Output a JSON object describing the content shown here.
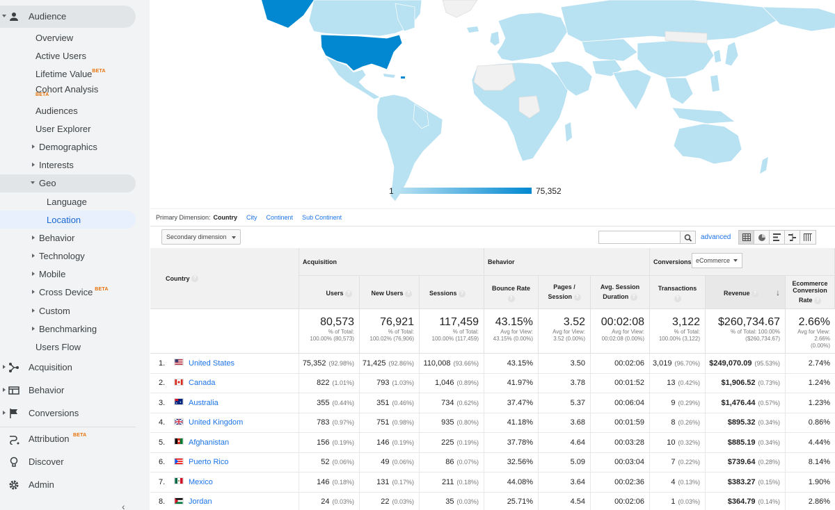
{
  "sidebar": {
    "audience": "Audience",
    "items": {
      "overview": "Overview",
      "active_users": "Active Users",
      "lifetime_value": "Lifetime Value",
      "lifetime_value_badge": "BETA",
      "cohort_analysis": "Cohort Analysis",
      "cohort_badge": "BETA",
      "audiences": "Audiences",
      "user_explorer": "User Explorer",
      "demographics": "Demographics",
      "interests": "Interests",
      "geo": "Geo",
      "language": "Language",
      "location": "Location",
      "behavior": "Behavior",
      "technology": "Technology",
      "mobile": "Mobile",
      "cross_device": "Cross Device",
      "cross_device_badge": "BETA",
      "custom": "Custom",
      "benchmarking": "Benchmarking",
      "users_flow": "Users Flow"
    },
    "acquisition": "Acquisition",
    "behavior": "Behavior",
    "conversions": "Conversions",
    "attribution": "Attribution",
    "attribution_badge": "BETA",
    "discover": "Discover",
    "admin": "Admin"
  },
  "map": {
    "legend_min": "1",
    "legend_max": "75,352",
    "colors": {
      "low": "#b8e1f2",
      "high": "#0288d1",
      "none": "#f1f1f1"
    }
  },
  "dimensions": {
    "label": "Primary Dimension:",
    "active": "Country",
    "links": [
      "City",
      "Continent",
      "Sub Continent"
    ]
  },
  "controls": {
    "secondary_dimension": "Secondary dimension",
    "advanced": "advanced"
  },
  "table": {
    "country_header": "Country",
    "groups": {
      "acquisition": "Acquisition",
      "behavior": "Behavior",
      "conversions": "Conversions",
      "conversions_select": "eCommerce"
    },
    "columns": {
      "users": "Users",
      "new_users": "New Users",
      "sessions": "Sessions",
      "bounce_rate": "Bounce Rate",
      "pages_l1": "Pages /",
      "pages_l2": "Session",
      "duration_l1": "Avg. Session",
      "duration_l2": "Duration",
      "transactions": "Transactions",
      "revenue": "Revenue",
      "conv_l1": "Ecommerce",
      "conv_l2": "Conversion",
      "conv_l3": "Rate"
    },
    "totals": {
      "users": {
        "value": "80,573",
        "sub1": "% of Total:",
        "sub2": "100.00% (80,573)"
      },
      "new_users": {
        "value": "76,921",
        "sub1": "% of Total:",
        "sub2": "100.02% (76,906)"
      },
      "sessions": {
        "value": "117,459",
        "sub1": "% of Total:",
        "sub2": "100.00% (117,459)"
      },
      "bounce_rate": {
        "value": "43.15%",
        "sub1": "Avg for View:",
        "sub2": "43.15% (0.00%)"
      },
      "pages": {
        "value": "3.52",
        "sub1": "Avg for View:",
        "sub2": "3.52 (0.00%)"
      },
      "duration": {
        "value": "00:02:08",
        "sub1": "Avg for View:",
        "sub2": "00:02:08 (0.00%)"
      },
      "transactions": {
        "value": "3,122",
        "sub1": "% of Total:",
        "sub2": "100.00% (3,122)"
      },
      "revenue": {
        "value": "$260,734.67",
        "sub1": "% of Total: 100.00%",
        "sub2": "($260,734.67)"
      },
      "conv": {
        "value": "2.66%",
        "sub1": "Avg for View:",
        "sub2": "2.66%",
        "sub3": "(0.00%)"
      }
    },
    "rows": [
      {
        "rank": "1.",
        "country": "United States",
        "users": "75,352",
        "users_pct": "(92.98%)",
        "new_users": "71,425",
        "new_users_pct": "(92.86%)",
        "sessions": "110,008",
        "sessions_pct": "(93.66%)",
        "bounce": "43.15%",
        "pages": "3.50",
        "duration": "00:02:06",
        "transactions": "3,019",
        "transactions_pct": "(96.70%)",
        "revenue": "$249,070.09",
        "revenue_pct": "(95.53%)",
        "conv": "2.74%"
      },
      {
        "rank": "2.",
        "country": "Canada",
        "users": "822",
        "users_pct": "(1.01%)",
        "new_users": "793",
        "new_users_pct": "(1.03%)",
        "sessions": "1,046",
        "sessions_pct": "(0.89%)",
        "bounce": "41.97%",
        "pages": "3.78",
        "duration": "00:01:52",
        "transactions": "13",
        "transactions_pct": "(0.42%)",
        "revenue": "$1,906.52",
        "revenue_pct": "(0.73%)",
        "conv": "1.24%"
      },
      {
        "rank": "3.",
        "country": "Australia",
        "users": "355",
        "users_pct": "(0.44%)",
        "new_users": "351",
        "new_users_pct": "(0.46%)",
        "sessions": "734",
        "sessions_pct": "(0.62%)",
        "bounce": "37.47%",
        "pages": "5.37",
        "duration": "00:06:04",
        "transactions": "9",
        "transactions_pct": "(0.29%)",
        "revenue": "$1,476.44",
        "revenue_pct": "(0.57%)",
        "conv": "1.23%"
      },
      {
        "rank": "4.",
        "country": "United Kingdom",
        "users": "783",
        "users_pct": "(0.97%)",
        "new_users": "751",
        "new_users_pct": "(0.98%)",
        "sessions": "935",
        "sessions_pct": "(0.80%)",
        "bounce": "41.18%",
        "pages": "3.68",
        "duration": "00:01:59",
        "transactions": "8",
        "transactions_pct": "(0.26%)",
        "revenue": "$895.32",
        "revenue_pct": "(0.34%)",
        "conv": "0.86%"
      },
      {
        "rank": "5.",
        "country": "Afghanistan",
        "users": "156",
        "users_pct": "(0.19%)",
        "new_users": "146",
        "new_users_pct": "(0.19%)",
        "sessions": "225",
        "sessions_pct": "(0.19%)",
        "bounce": "37.78%",
        "pages": "4.64",
        "duration": "00:03:28",
        "transactions": "10",
        "transactions_pct": "(0.32%)",
        "revenue": "$885.19",
        "revenue_pct": "(0.34%)",
        "conv": "4.44%"
      },
      {
        "rank": "6.",
        "country": "Puerto Rico",
        "users": "52",
        "users_pct": "(0.06%)",
        "new_users": "49",
        "new_users_pct": "(0.06%)",
        "sessions": "86",
        "sessions_pct": "(0.07%)",
        "bounce": "32.56%",
        "pages": "5.09",
        "duration": "00:03:04",
        "transactions": "7",
        "transactions_pct": "(0.22%)",
        "revenue": "$739.64",
        "revenue_pct": "(0.28%)",
        "conv": "8.14%"
      },
      {
        "rank": "7.",
        "country": "Mexico",
        "users": "146",
        "users_pct": "(0.18%)",
        "new_users": "131",
        "new_users_pct": "(0.17%)",
        "sessions": "211",
        "sessions_pct": "(0.18%)",
        "bounce": "44.08%",
        "pages": "3.64",
        "duration": "00:02:36",
        "transactions": "4",
        "transactions_pct": "(0.13%)",
        "revenue": "$383.27",
        "revenue_pct": "(0.15%)",
        "conv": "1.90%"
      },
      {
        "rank": "8.",
        "country": "Jordan",
        "users": "24",
        "users_pct": "(0.03%)",
        "new_users": "22",
        "new_users_pct": "(0.03%)",
        "sessions": "35",
        "sessions_pct": "(0.03%)",
        "bounce": "25.71%",
        "pages": "4.54",
        "duration": "00:02:06",
        "transactions": "1",
        "transactions_pct": "(0.03%)",
        "revenue": "$364.79",
        "revenue_pct": "(0.14%)",
        "conv": "2.86%"
      }
    ]
  }
}
